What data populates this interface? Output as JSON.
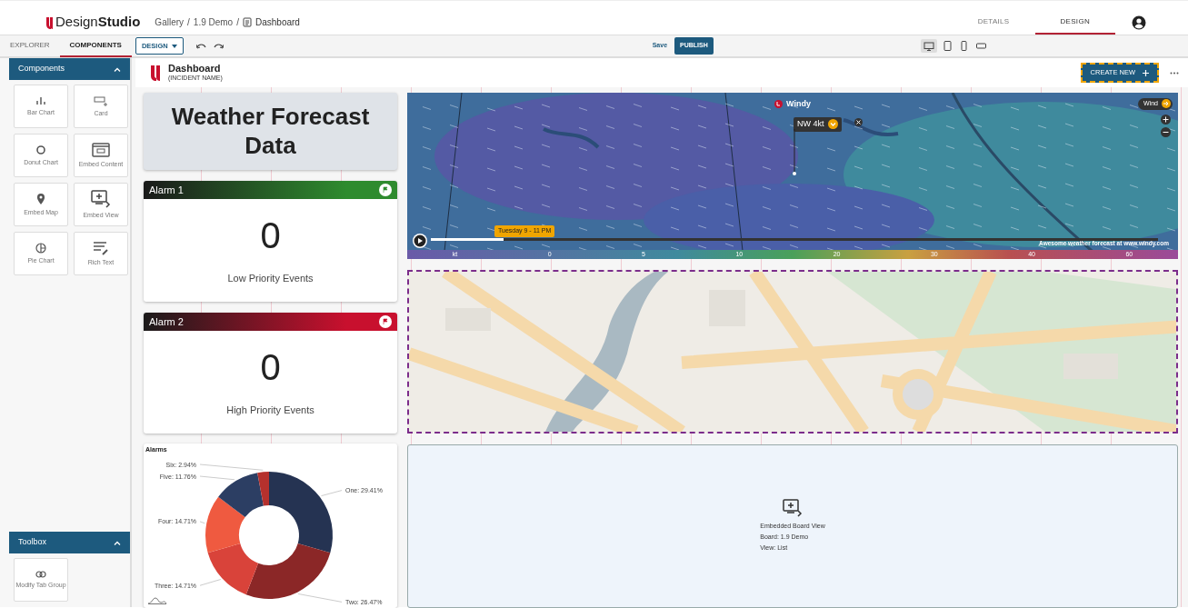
{
  "topbar": {
    "brand": "Design**Studio**",
    "breadcrumb": [
      {
        "kind": "link",
        "label": "Gallery"
      },
      {
        "kind": "separator",
        "label": "/"
      },
      {
        "kind": "link",
        "label": "1.9 Demo"
      },
      {
        "kind": "separator",
        "label": "/"
      },
      {
        "kind": "page",
        "label": "Dashboard"
      }
    ],
    "tabs": [
      {
        "label": "DETAILS",
        "selected": false
      },
      {
        "label": "DESIGN",
        "selected": true
      }
    ]
  },
  "left_tabs": [
    {
      "label": "EXPLORER",
      "selected": false
    },
    {
      "label": "COMPONENTS",
      "selected": true
    }
  ],
  "toolbar": {
    "mode": "DESIGN",
    "save": "Save",
    "publish": "PUBLISH",
    "devices": [
      {
        "kind": "desktop",
        "selected": true
      },
      {
        "kind": "tablet",
        "selected": false
      },
      {
        "kind": "phone",
        "selected": false
      },
      {
        "kind": "landscape",
        "selected": false
      }
    ]
  },
  "sidebar": {
    "panels": [
      {
        "title": "Components",
        "expanded": true,
        "items": [
          {
            "kind": "bar",
            "label": "Bar Chart"
          },
          {
            "kind": "card",
            "label": "Card"
          },
          {
            "kind": "donut",
            "label": "Donut Chart"
          },
          {
            "kind": "embed",
            "label": "Embed Content"
          },
          {
            "kind": "pin",
            "label": "Embed Map"
          },
          {
            "kind": "view",
            "label": "Embed View"
          },
          {
            "kind": "pie",
            "label": "Pie Chart"
          },
          {
            "kind": "text",
            "label": "Rich Text"
          }
        ]
      },
      {
        "title": "Toolbox",
        "expanded": true,
        "items": [
          {
            "kind": "link",
            "label": "Modify Tab Group"
          }
        ]
      }
    ]
  },
  "dashboard": {
    "title": "Dashboard",
    "subtitle": "(INCIDENT NAME)",
    "create_button": "CREATE NEW",
    "title_card": "Weather Forecast Data",
    "alarms": [
      {
        "title": "Alarm 1",
        "count": "0",
        "caption": "Low Priority Events",
        "color": "#2e8b2e"
      },
      {
        "title": "Alarm 2",
        "count": "0",
        "caption": "High Priority Events",
        "color": "#c8102e"
      }
    ],
    "chart_card": {
      "title": "Alarms",
      "chart_data": {
        "type": "donut",
        "values": [
          29.41,
          26.47,
          14.71,
          14.71,
          11.76,
          2.94
        ],
        "colors": [
          "#253352",
          "#8b2727",
          "#d9433a",
          "#ef5a40",
          "#2c3e63",
          "#b5312d"
        ],
        "value_labels": [
          "One: 29.41%",
          "Two: 26.47%",
          "Three: 14.71%",
          "Four: 14.71%",
          "Five: 11.76%",
          "Six: 2.94%"
        ]
      }
    },
    "weather_map": {
      "kind": "picture",
      "logo": "Windy",
      "layer_button": "Wind",
      "wind_popup": "NW 4kt",
      "timeline_label": "Tuesday 9 - 11 PM",
      "timeline": {
        "level": 0.1
      },
      "attribution": "Awesome weather forecast at www.windy.com",
      "scale": [
        "kt",
        "0",
        "5",
        "10",
        "20",
        "30",
        "40",
        "60"
      ]
    },
    "street_map": {
      "kind": "picture",
      "selected": true
    },
    "embed_view": {
      "lines": [
        "Embedded Board View",
        "Board: 1.9 Demo",
        "View: List"
      ]
    }
  }
}
